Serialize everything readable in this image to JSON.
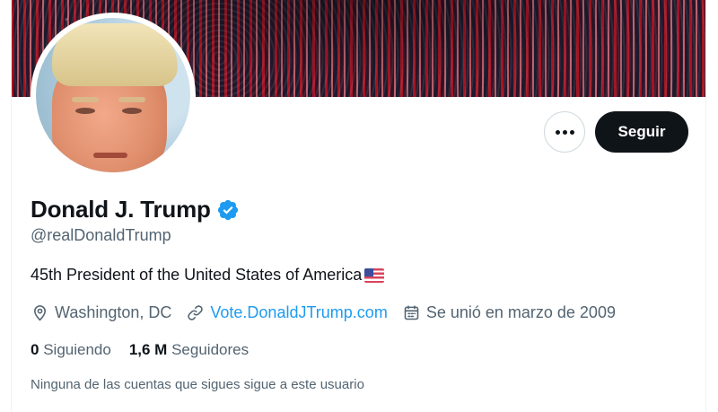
{
  "profile": {
    "name": "Donald J. Trump",
    "handle": "@realDonaldTrump",
    "bio": "45th President of the United States of America",
    "bio_emoji": "us-flag-emoji",
    "location": "Washington, DC",
    "website": "Vote.DonaldJTrump.com",
    "joined": "Se unió en marzo de 2009",
    "following_count": "0",
    "following_label": "Siguiendo",
    "followers_count": "1,6 M",
    "followers_label": "Seguidores",
    "followed_by_note": "Ninguna de las cuentas que sigues sigue a este usuario"
  },
  "actions": {
    "follow_label": "Seguir",
    "more_icon": "more-horizontal-icon"
  },
  "icons": {
    "verified": "verified-badge-icon",
    "location": "location-pin-icon",
    "link": "link-icon",
    "calendar": "calendar-icon"
  },
  "colors": {
    "accent": "#1d9bf0",
    "text_primary": "#0f1419",
    "text_secondary": "#536471",
    "follow_button_bg": "#0f1419"
  }
}
